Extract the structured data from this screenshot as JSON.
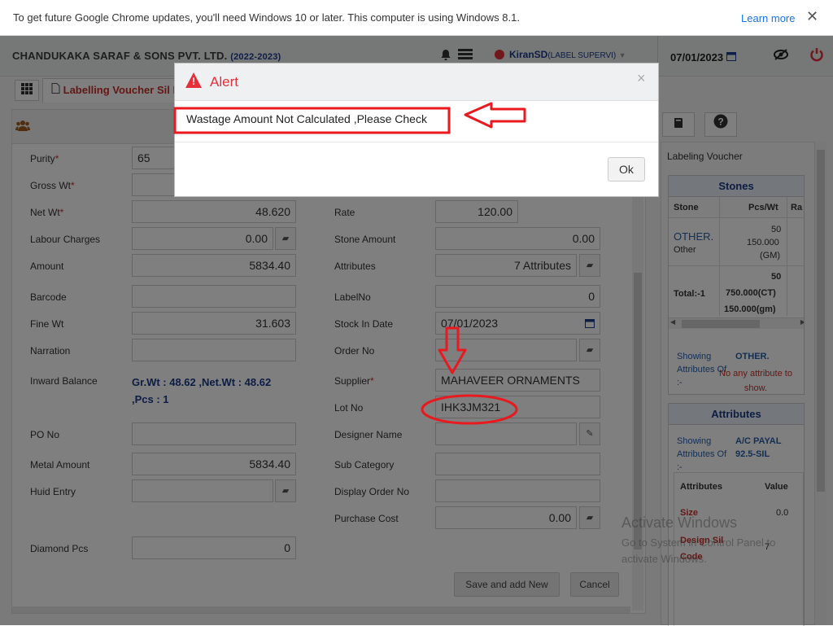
{
  "infobar": {
    "message": "To get future Google Chrome updates, you'll need Windows 10 or later. This computer is using Windows 8.1.",
    "learn_more": "Learn more",
    "close": "✕"
  },
  "header": {
    "company": "CHANDUKAKA SARAF & SONS PVT. LTD.",
    "year": "(2022-2023)",
    "user_name": "KiranSD",
    "user_role": "(LABEL SUPERVI)",
    "date": "07/01/2023"
  },
  "tab": {
    "label": "Labelling Voucher Sil N"
  },
  "form": {
    "purity": {
      "label": "Purity",
      "value": "65"
    },
    "gross_wt": {
      "label": "Gross Wt",
      "value": ""
    },
    "net_wt": {
      "label": "Net Wt",
      "value": "48.620"
    },
    "labour": {
      "label": "Labour Charges",
      "value": "0.00"
    },
    "amount": {
      "label": "Amount",
      "value": "5834.40"
    },
    "barcode": {
      "label": "Barcode",
      "value": ""
    },
    "fine_wt": {
      "label": "Fine Wt",
      "value": "31.603"
    },
    "narration": {
      "label": "Narration",
      "value": ""
    },
    "inward": {
      "label": "Inward Balance",
      "value": "Gr.Wt : 48.62 ,Net.Wt : 48.62 ,Pcs : 1"
    },
    "po_no": {
      "label": "PO No",
      "value": ""
    },
    "metal_amount": {
      "label": "Metal Amount",
      "value": "5834.40"
    },
    "huid": {
      "label": "Huid Entry",
      "value": ""
    },
    "diamond_pcs": {
      "label": "Diamond Pcs",
      "value": "0"
    },
    "rate": {
      "label": "Rate",
      "value": "120.00"
    },
    "stone_amount": {
      "label": "Stone Amount",
      "value": "0.00"
    },
    "attributes": {
      "label": "Attributes",
      "value": "7 Attributes"
    },
    "label_no": {
      "label": "LabelNo",
      "value": "0"
    },
    "stock_date": {
      "label": "Stock In Date",
      "value": "07/01/2023"
    },
    "order_no": {
      "label": "Order No",
      "value": ""
    },
    "supplier": {
      "label": "Supplier",
      "value": "MAHAVEER ORNAMENTS"
    },
    "lot_no": {
      "label": "Lot No",
      "value": "IHK3JM321"
    },
    "designer": {
      "label": "Designer Name",
      "value": ""
    },
    "sub_category": {
      "label": "Sub Category",
      "value": ""
    },
    "display_order": {
      "label": "Display Order No",
      "value": ""
    },
    "purchase_cost": {
      "label": "Purchase Cost",
      "value": "0.00"
    },
    "save_add": "Save and add New",
    "cancel": "Cancel"
  },
  "side": {
    "title": "Labeling Voucher",
    "stones": {
      "heading": "Stones",
      "col_stone": "Stone",
      "col_pcswt": "Pcs/Wt",
      "col_rate": "Ra",
      "row_stone": "OTHER.",
      "row_type": "Other",
      "row_pcs": "50",
      "row_wt": "150.000",
      "row_unit": "(GM)",
      "total_label": "Total:-1",
      "total_pcs": "50",
      "total_ct": "750.000(CT)",
      "total_gm": "150.000(gm)",
      "showing": "Showing Attributes Of :-",
      "showing_item": "OTHER.",
      "no_attr": "No any attribute to show."
    },
    "attributes": {
      "heading": "Attributes",
      "showing": "Showing Attributes Of :-",
      "showing_item": "A/C PAYAL 92.5-SIL",
      "col_attr": "Attributes",
      "col_value": "Value",
      "r1_name": "Size",
      "r1_val": "0.0",
      "r2_name": "Design Sil Code",
      "r2_val": "7"
    }
  },
  "watermark": {
    "title": "Activate Windows",
    "line1": "Go to System in Control Panel to",
    "line2": "activate Windows."
  },
  "modal": {
    "title": "Alert",
    "message": "Wastage Amount Not Calculated ,Please Check",
    "ok": "Ok",
    "close": "×"
  },
  "colors": {
    "alert_red": "#e5303a",
    "brand_blue": "#1a3a8a",
    "annotation_red": "#e8191f"
  }
}
